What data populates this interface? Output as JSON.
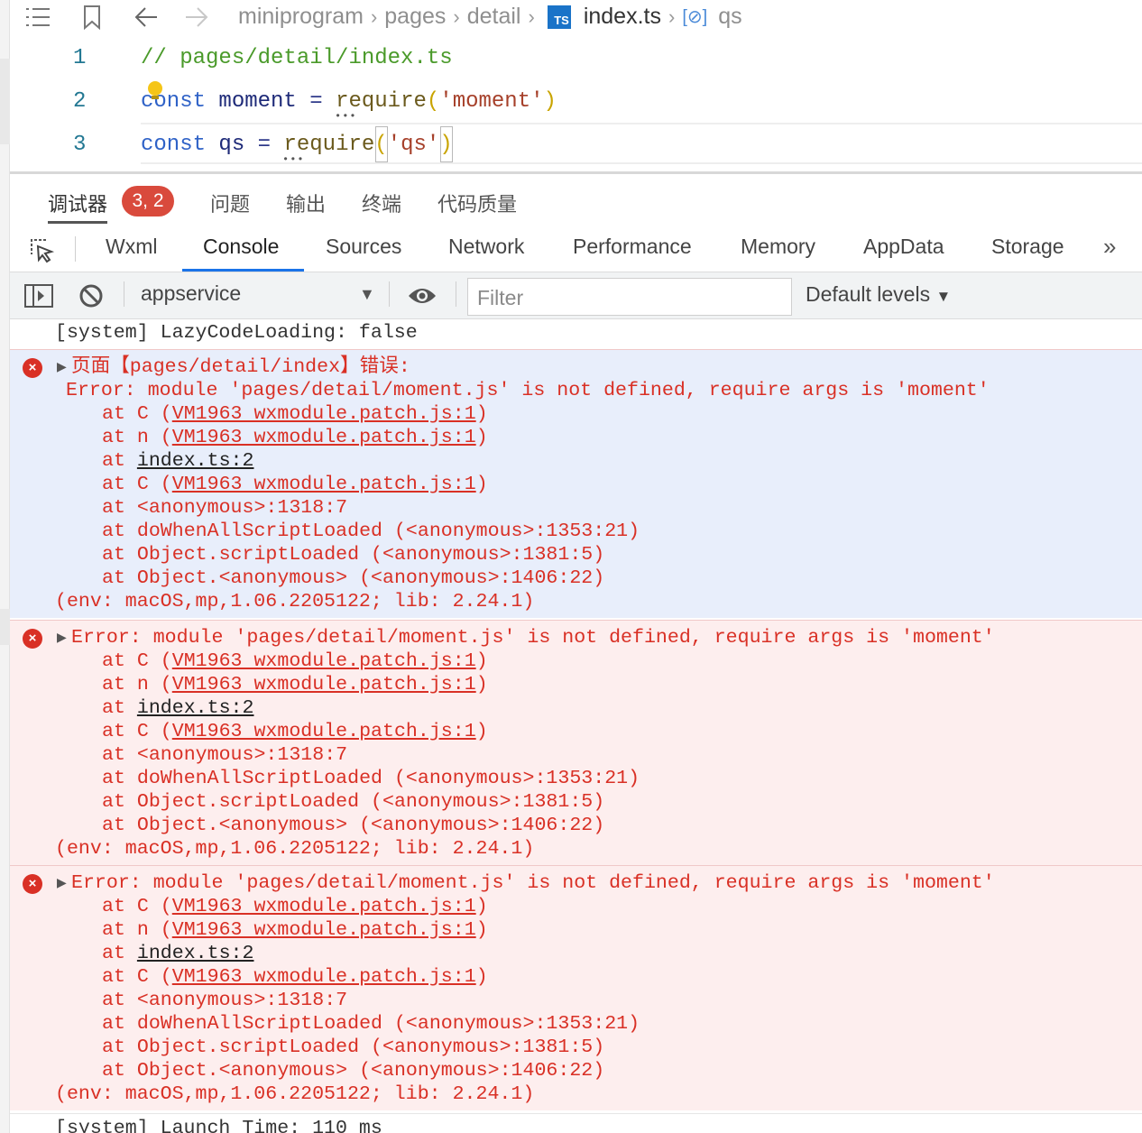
{
  "breadcrumb": {
    "items": [
      "miniprogram",
      "pages",
      "detail"
    ],
    "file_badge": "TS",
    "file": "index.ts",
    "symbol": "qs"
  },
  "editor": {
    "lines": [
      {
        "number": "1",
        "text": "// pages/detail/index.ts"
      },
      {
        "number": "2",
        "kw": "const",
        "id": "moment",
        "op": "=",
        "fn": "require",
        "arg": "'moment'"
      },
      {
        "number": "3",
        "kw": "const",
        "id": "qs",
        "op": "=",
        "fn": "require",
        "arg": "'qs'"
      }
    ]
  },
  "panel_tabs": {
    "debugger": "调试器",
    "badge": "3, 2",
    "problems": "问题",
    "output": "输出",
    "terminal": "终端",
    "code_quality": "代码质量"
  },
  "devtools_tabs": [
    "Wxml",
    "Console",
    "Sources",
    "Network",
    "Performance",
    "Memory",
    "AppData",
    "Storage"
  ],
  "devtools_active_tab": "Console",
  "toolbar": {
    "context": "appservice",
    "filter_placeholder": "Filter",
    "levels": "Default levels"
  },
  "console": {
    "system_first": "[system] LazyCodeLoading: false",
    "error1_header": "页面【pages/detail/index】错误:",
    "error_message": "Error: module 'pages/detail/moment.js' is not defined, require args is 'moment'",
    "stack": [
      {
        "prefix": "at C (",
        "link": "VM1963 wxmodule.patch.js:1",
        "suffix": ")"
      },
      {
        "prefix": "at n (",
        "link": "VM1963 wxmodule.patch.js:1",
        "suffix": ")"
      },
      {
        "prefix": "at ",
        "link": "index.ts:2",
        "suffix": ""
      },
      {
        "prefix": "at C (",
        "link": "VM1963 wxmodule.patch.js:1",
        "suffix": ")"
      },
      {
        "prefix": "at <anonymous>:1318:7",
        "link": "",
        "suffix": ""
      },
      {
        "prefix": "at doWhenAllScriptLoaded (<anonymous>:1353:21)",
        "link": "",
        "suffix": ""
      },
      {
        "prefix": "at Object.scriptLoaded (<anonymous>:1381:5)",
        "link": "",
        "suffix": ""
      },
      {
        "prefix": "at Object.<anonymous> (<anonymous>:1406:22)",
        "link": "",
        "suffix": ""
      }
    ],
    "env": "(env: macOS,mp,1.06.2205122; lib: 2.24.1)",
    "system_last": "[system] Launch Time: 110 ms"
  },
  "colors": {
    "error_red": "#d93025",
    "selected_bg": "#e8eefb",
    "error_bg": "#fdeeee",
    "active_tab_underline": "#1a73e8",
    "badge_red": "#d94a3c"
  }
}
